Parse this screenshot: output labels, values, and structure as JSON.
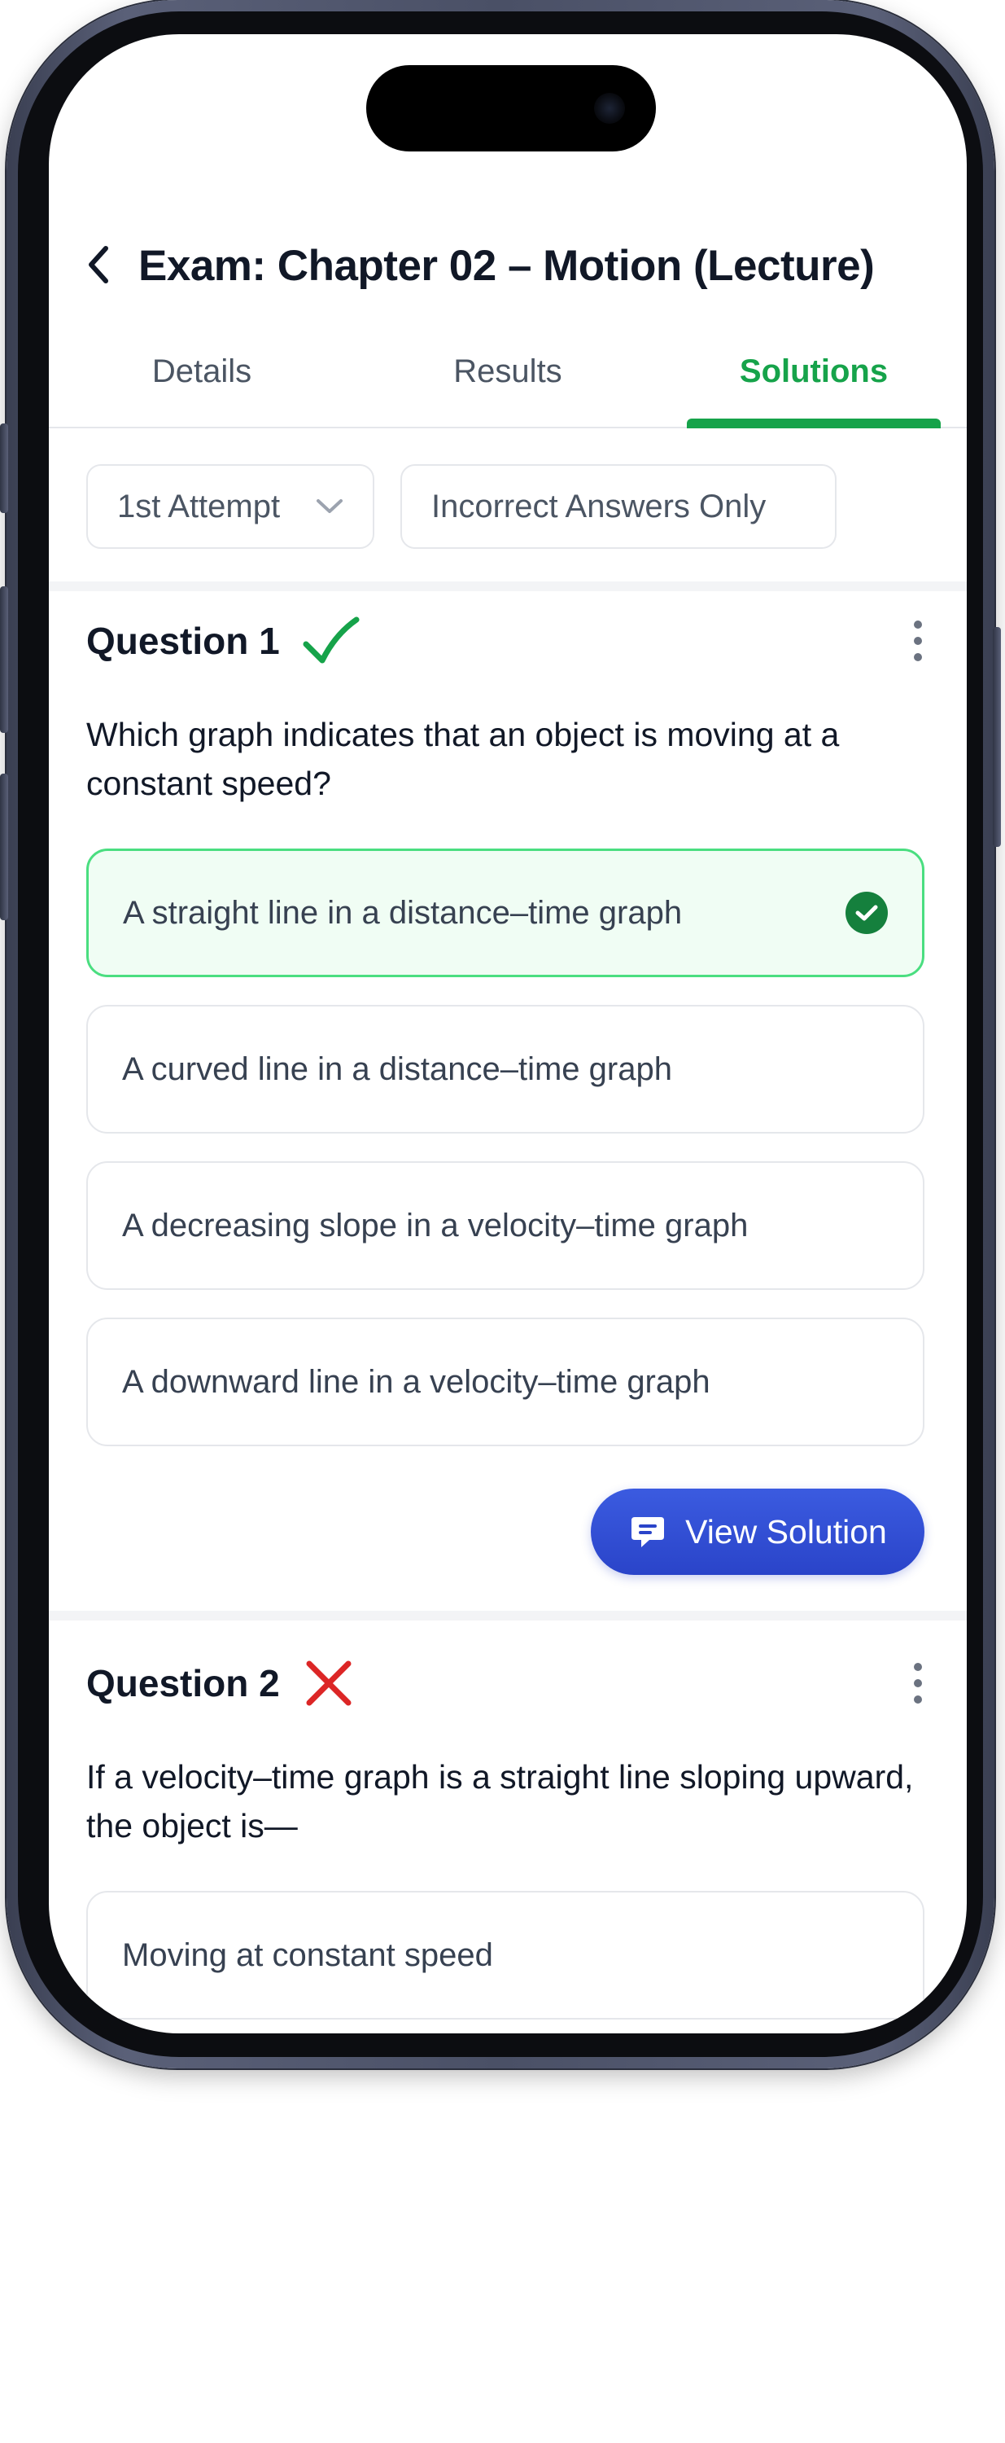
{
  "header": {
    "title": "Exam: Chapter 02 – Motion (Lecture)"
  },
  "tabs": [
    {
      "label": "Details",
      "active": false
    },
    {
      "label": "Results",
      "active": false
    },
    {
      "label": "Solutions",
      "active": true
    }
  ],
  "filters": {
    "attempt": "1st Attempt",
    "incorrect_only": "Incorrect Answers Only"
  },
  "questions": [
    {
      "title": "Question 1",
      "status": "correct",
      "text": "Which graph indicates that an object is moving at a constant speed?",
      "options": [
        {
          "label": "A straight line in a distance–time graph",
          "selected_correct": true
        },
        {
          "label": "A curved line in a distance–time graph",
          "selected_correct": false
        },
        {
          "label": "A decreasing slope in a velocity–time graph",
          "selected_correct": false
        },
        {
          "label": "A downward line in a velocity–time graph",
          "selected_correct": false
        }
      ],
      "action_label": "View Solution"
    },
    {
      "title": "Question 2",
      "status": "incorrect",
      "text": "If a velocity–time graph is a straight line sloping upward, the object is—",
      "options": [
        {
          "label": "Moving at constant speed",
          "selected_correct": false
        }
      ]
    }
  ],
  "colors": {
    "accent_green": "#16a34a",
    "correct_bg": "#f0fdf4",
    "correct_border": "#4ade80",
    "incorrect_red": "#dc2626",
    "button_blue": "#2a44c9"
  },
  "icons": {
    "back": "chevron-left-icon",
    "attempt_dropdown": "chevron-down-icon",
    "correct": "checkmark-icon",
    "incorrect": "cross-icon",
    "more": "kebab-icon",
    "solution": "chat-bubble-icon"
  }
}
